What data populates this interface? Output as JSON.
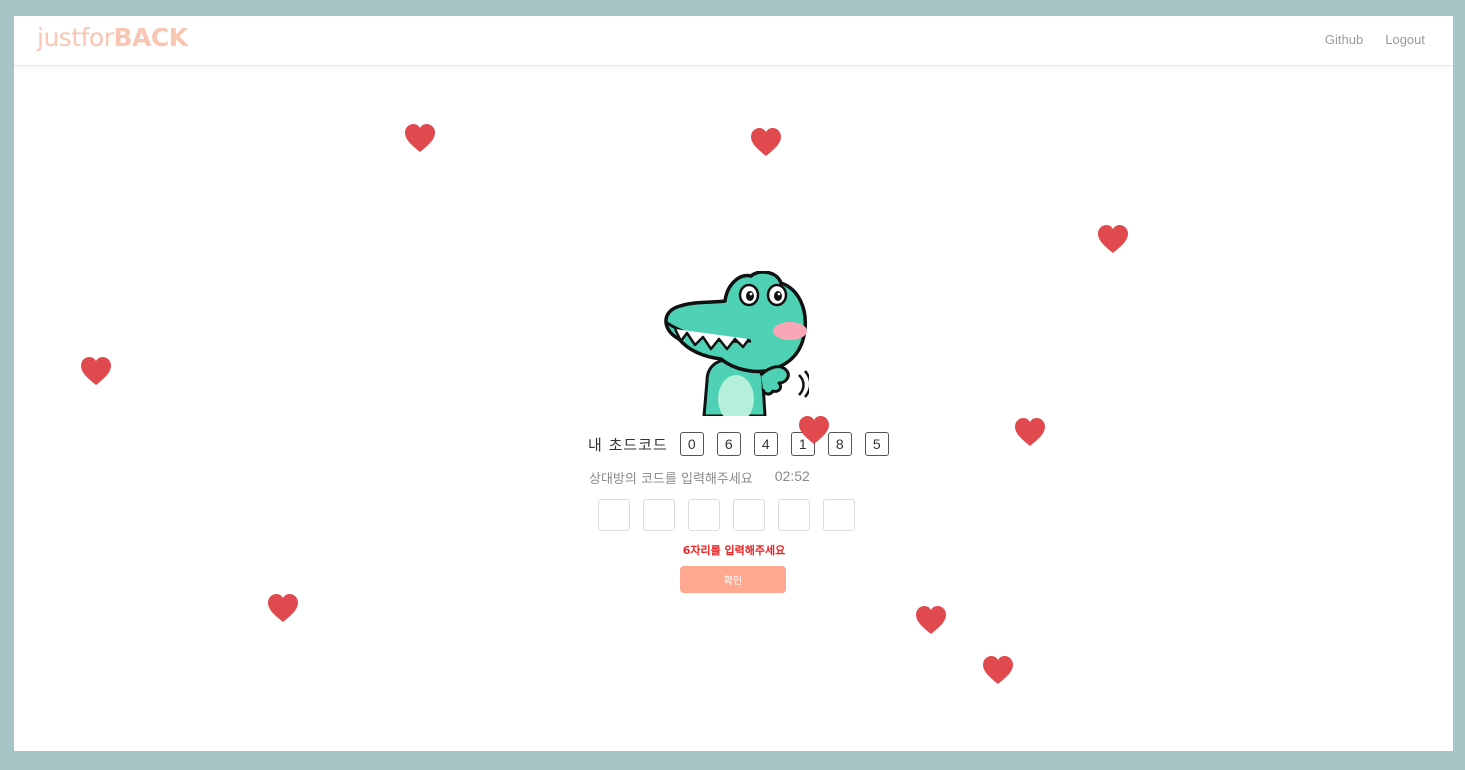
{
  "nav": {
    "brand_light": "justfor",
    "brand_bold": "BACK",
    "links": [
      "Github",
      "Logout"
    ]
  },
  "my_code": {
    "label": "내 초드코드",
    "digits": [
      "0",
      "6",
      "4",
      "1",
      "8",
      "5"
    ]
  },
  "partner": {
    "prompt": "상대방의 코드를 입력해주세요",
    "timer": "02:52",
    "inputs": [
      "",
      "",
      "",
      "",
      "",
      ""
    ]
  },
  "error": "6자리를 입력해주세요",
  "confirm_label": "확인",
  "colors": {
    "background": "#a7c4c6",
    "brand": "#f8c6b2",
    "heart": "#e04a4f",
    "button": "#fda88f",
    "error": "#ee2222",
    "dino": "#4ed1b4"
  }
}
